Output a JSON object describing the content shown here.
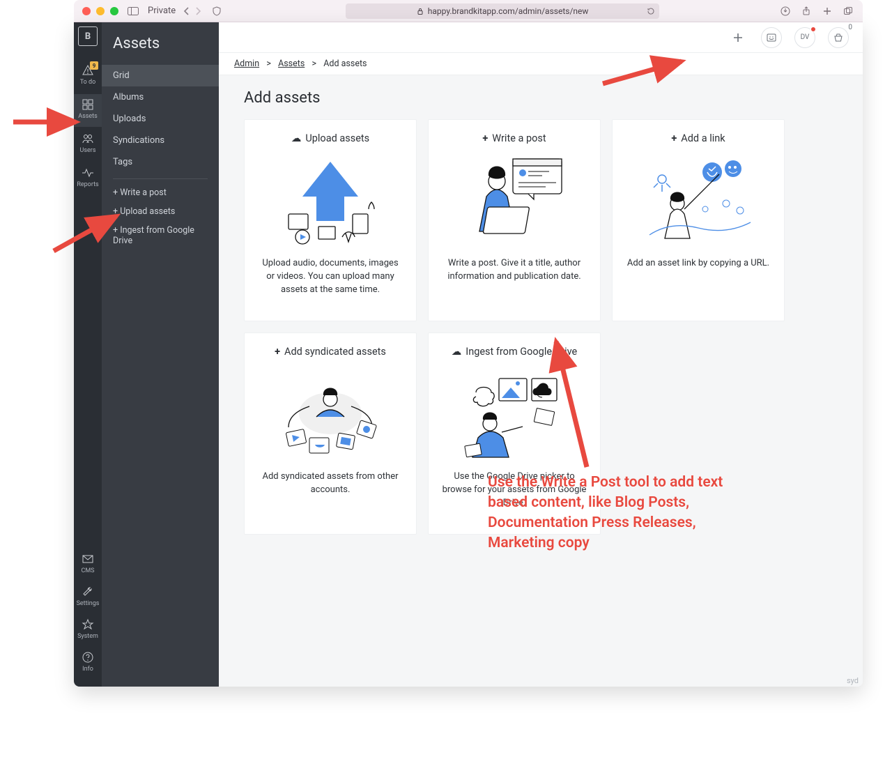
{
  "browser": {
    "private_label": "Private",
    "url": "happy.brandkitapp.com/admin/assets/new"
  },
  "rail": {
    "badge": "9",
    "items": [
      {
        "label": "To do"
      },
      {
        "label": "Assets"
      },
      {
        "label": "Users"
      },
      {
        "label": "Reports"
      }
    ],
    "bottom": [
      {
        "label": "CMS"
      },
      {
        "label": "Settings"
      },
      {
        "label": "System"
      },
      {
        "label": "Info"
      }
    ]
  },
  "sidebar": {
    "title": "Assets",
    "items": [
      {
        "label": "Grid"
      },
      {
        "label": "Albums"
      },
      {
        "label": "Uploads"
      },
      {
        "label": "Syndications"
      },
      {
        "label": "Tags"
      }
    ],
    "actions": [
      {
        "label": "+ Write a post"
      },
      {
        "label": "+ Upload assets"
      },
      {
        "label": "+ Ingest from Google Drive"
      }
    ]
  },
  "topbar": {
    "avatar_initials": "DV",
    "basket_count": "0"
  },
  "breadcrumb": {
    "root": "Admin",
    "mid": "Assets",
    "leaf": "Add assets"
  },
  "page_title": "Add assets",
  "cards": [
    {
      "title": "Upload assets",
      "desc": "Upload audio, documents, images or videos. You can upload many assets at the same time."
    },
    {
      "title": "Write a post",
      "desc": "Write a post. Give it a title, author information and publication date."
    },
    {
      "title": "Add a link",
      "desc": "Add an asset link by copying a URL."
    },
    {
      "title": "Add syndicated assets",
      "desc": "Add syndicated assets from other accounts."
    },
    {
      "title": "Ingest from Google Drive",
      "desc": "Use the Google Drive picker to browse for your assets from Google Drive."
    }
  ],
  "annotation_text": "Use the Write a Post tool to add text based content, like Blog Posts, Documentation Press Releases, Marketing copy",
  "footer_tag": "syd"
}
